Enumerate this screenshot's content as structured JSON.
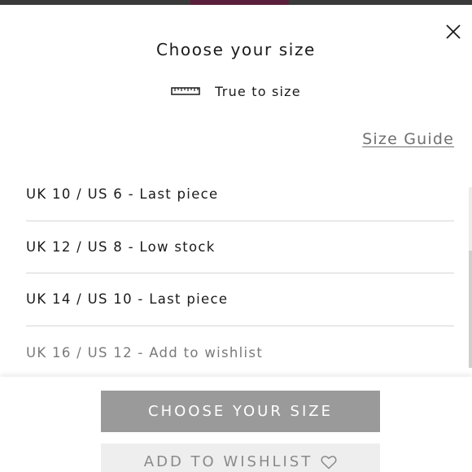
{
  "header": {
    "title": "Choose your size",
    "fit_icon": "ruler-icon",
    "fit_label": "True to size",
    "close_icon": "close-icon"
  },
  "size_guide": {
    "label": "Size Guide"
  },
  "sizes": [
    {
      "label": "UK 10 / US 6 - Last piece",
      "available": true
    },
    {
      "label": "UK 12 / US 8 - Low stock",
      "available": true
    },
    {
      "label": "UK 14 / US 10 - Last piece",
      "available": true
    },
    {
      "label": "UK 16 / US 12 - Add to wishlist",
      "available": false
    }
  ],
  "actions": {
    "choose_label": "CHOOSE YOUR SIZE",
    "wishlist_label": "ADD TO WISHLIST",
    "wishlist_icon": "heart-icon"
  },
  "colors": {
    "primary_button": "#9a9a9a",
    "secondary_button": "#eeeeee",
    "text": "#1a1a1a",
    "muted_text": "#7a7a7a",
    "divider": "#d6d6d6"
  }
}
